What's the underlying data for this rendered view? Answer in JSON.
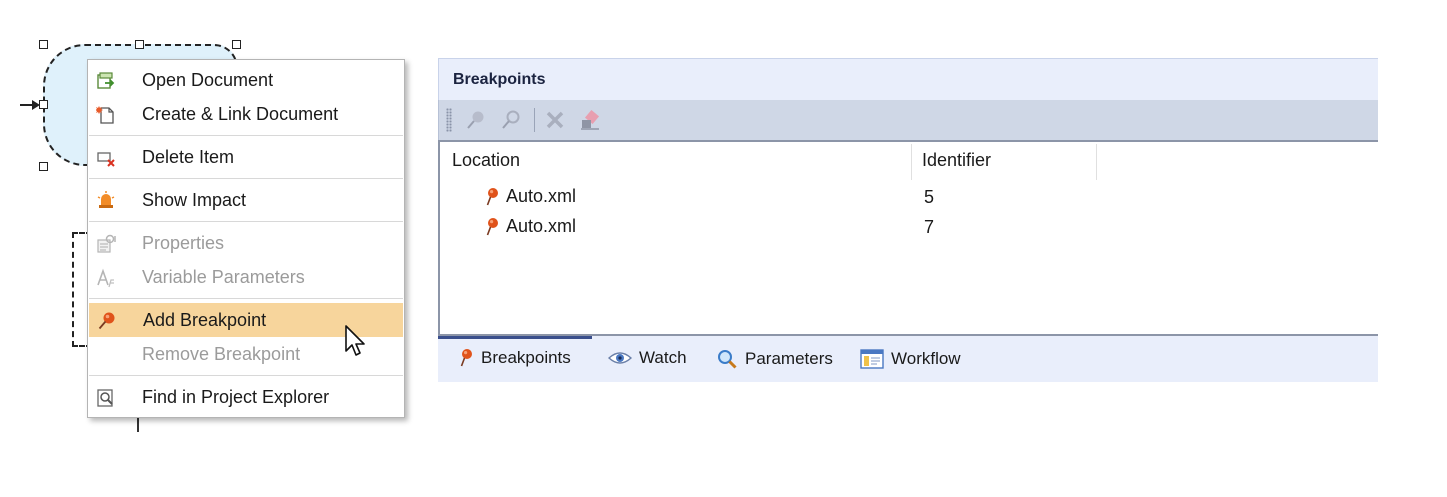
{
  "context_menu": {
    "items": [
      {
        "label": "Open Document",
        "icon": "open-document-icon",
        "enabled": true
      },
      {
        "label": "Create & Link Document",
        "icon": "create-link-document-icon",
        "enabled": true
      },
      {
        "label": "Delete Item",
        "icon": "delete-item-icon",
        "enabled": true
      },
      {
        "label": "Show Impact",
        "icon": "show-impact-icon",
        "enabled": true
      },
      {
        "label": "Properties",
        "icon": "properties-icon",
        "enabled": false
      },
      {
        "label": "Variable Parameters",
        "icon": "variable-parameters-icon",
        "enabled": false
      },
      {
        "label": "Add Breakpoint",
        "icon": "breakpoint-pin-icon",
        "enabled": true,
        "highlighted": true
      },
      {
        "label": "Remove Breakpoint",
        "icon": "",
        "enabled": false
      },
      {
        "label": "Find in Project Explorer",
        "icon": "find-in-explorer-icon",
        "enabled": true
      }
    ]
  },
  "breakpoints_panel": {
    "title": "Breakpoints",
    "columns": [
      "Location",
      "Identifier"
    ],
    "rows": [
      {
        "location": "Auto.xml",
        "identifier": "5"
      },
      {
        "location": "Auto.xml",
        "identifier": "7"
      }
    ],
    "tabs": [
      {
        "label": "Breakpoints",
        "icon": "breakpoint-pin-icon",
        "active": true
      },
      {
        "label": "Watch",
        "icon": "eye-icon",
        "active": false
      },
      {
        "label": "Parameters",
        "icon": "magnifier-icon",
        "active": false
      },
      {
        "label": "Workflow",
        "icon": "workflow-window-icon",
        "active": false
      }
    ]
  },
  "colors": {
    "menu_highlight": "#f7d59c",
    "panel_header": "#e9eefb",
    "toolbar": "#cfd7e6",
    "shape_fill": "#dff1fb",
    "breakpoint_pin": "#e0531b"
  }
}
